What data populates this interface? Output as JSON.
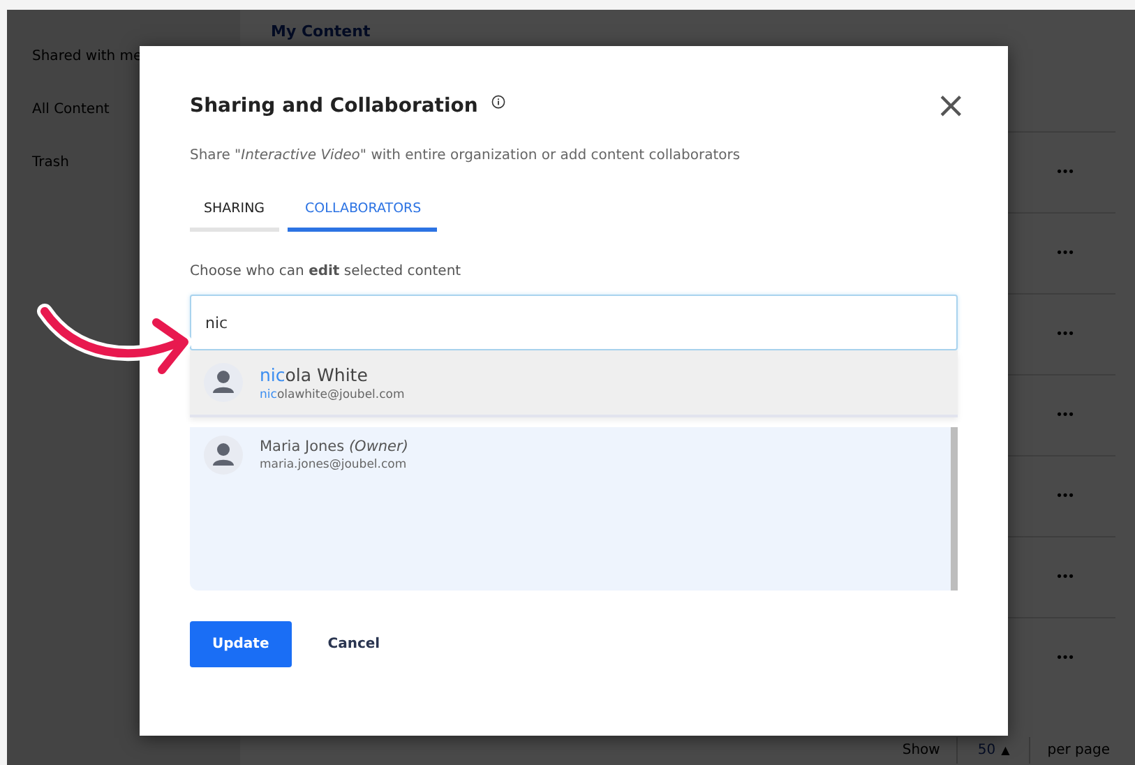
{
  "sidebar": {
    "items": [
      {
        "label": "Shared with me",
        "selected": false
      },
      {
        "label": "All Content",
        "selected": false
      },
      {
        "label": "Trash",
        "selected": false
      }
    ]
  },
  "main": {
    "heading": "My Content",
    "row_menus": [
      "•••",
      "•••",
      "•••",
      "•••",
      "•••",
      "•••",
      "•••"
    ],
    "pagination": {
      "show_label": "Show",
      "per_page_value": "50",
      "caret": "▲",
      "per_page_label": "per page"
    }
  },
  "dialog": {
    "title": "Sharing and Collaboration",
    "close": "×",
    "subtitle": "Share *\"Interactive Video\"* with entire organization or add content collaborators",
    "tabs": [
      {
        "label": "SHARING",
        "selected": false
      },
      {
        "label": "COLLABORATORS",
        "selected": true
      }
    ],
    "field_label": "Choose who can **edit** selected content",
    "search": {
      "value": "nic"
    },
    "suggestions": [
      {
        "name_match": "nic",
        "name_rest": "ola White",
        "email_match": "nic",
        "email_rest": "olawhite@joubel.com"
      }
    ],
    "collaborators": [
      {
        "name": "Maria Jones",
        "role": "(Owner)",
        "email": "maria.jones@joubel.com"
      }
    ],
    "buttons": [
      {
        "label": "Update",
        "kind": "primary"
      },
      {
        "label": "Cancel",
        "kind": "secondary"
      }
    ]
  },
  "annotation": {
    "kind": "arrow"
  }
}
